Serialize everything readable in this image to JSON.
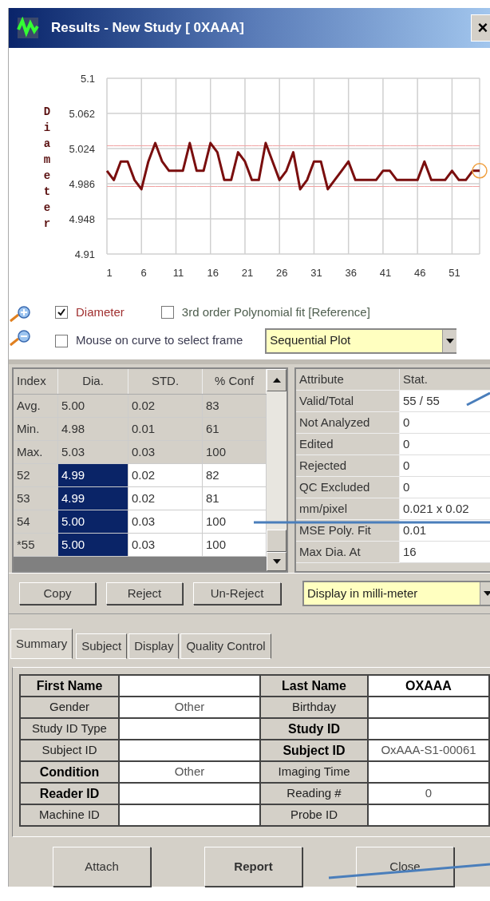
{
  "window": {
    "title": "Results - New Study [ 0XAAA]",
    "close": "×"
  },
  "plot": {
    "chart_data": {
      "type": "line",
      "ylabel": "Diameter",
      "x": [
        1,
        2,
        3,
        4,
        5,
        6,
        7,
        8,
        9,
        10,
        11,
        12,
        13,
        14,
        15,
        16,
        17,
        18,
        19,
        20,
        21,
        22,
        23,
        24,
        25,
        26,
        27,
        28,
        29,
        30,
        31,
        32,
        33,
        34,
        35,
        36,
        37,
        38,
        39,
        40,
        41,
        42,
        43,
        44,
        45,
        46,
        47,
        48,
        49,
        50,
        51,
        52,
        53,
        54,
        55
      ],
      "grid": true,
      "series": [
        {
          "color": "#7a0e0e",
          "values": [
            5.0,
            4.99,
            5.01,
            5.01,
            4.99,
            4.98,
            5.01,
            5.03,
            5.01,
            5.0,
            5.0,
            5.0,
            5.03,
            5.0,
            5.0,
            5.03,
            5.02,
            4.99,
            4.99,
            5.02,
            5.01,
            4.99,
            4.99,
            5.03,
            5.01,
            4.99,
            5.0,
            5.02,
            4.98,
            4.99,
            5.01,
            5.01,
            4.98,
            4.99,
            5.0,
            5.01,
            4.99,
            4.99,
            4.99,
            4.99,
            5.0,
            5.0,
            4.99,
            4.99,
            4.99,
            4.99,
            5.01,
            4.99,
            4.99,
            4.99,
            5.0,
            4.99,
            4.99,
            5.0,
            5.0
          ]
        },
        {
          "color": "#f0a0a0",
          "values": [
            5.027,
            5.027,
            5.027,
            5.027,
            5.027,
            5.027,
            5.027,
            5.027,
            5.027,
            5.027,
            5.027,
            5.027,
            5.027,
            5.027,
            5.027,
            5.027,
            5.027,
            5.027,
            5.027,
            5.027,
            5.027,
            5.027,
            5.027,
            5.027,
            5.027,
            5.027,
            5.027,
            5.027,
            5.027,
            5.027,
            5.027,
            5.027,
            5.027,
            5.027,
            5.027,
            5.027,
            5.027,
            5.027,
            5.027,
            5.027,
            5.027,
            5.027,
            5.027,
            5.027,
            5.027,
            5.027,
            5.027,
            5.027,
            5.027,
            5.027,
            5.027,
            5.027,
            5.027,
            5.027,
            5.027
          ]
        },
        {
          "color": "#f0a0a0",
          "values": [
            4.983,
            4.983,
            4.983,
            4.983,
            4.983,
            4.983,
            4.983,
            4.983,
            4.983,
            4.983,
            4.983,
            4.983,
            4.983,
            4.983,
            4.983,
            4.983,
            4.983,
            4.983,
            4.983,
            4.983,
            4.983,
            4.983,
            4.983,
            4.983,
            4.983,
            4.983,
            4.983,
            4.983,
            4.983,
            4.983,
            4.983,
            4.983,
            4.983,
            4.983,
            4.983,
            4.983,
            4.983,
            4.983,
            4.983,
            4.983,
            4.983,
            4.983,
            4.983,
            4.983,
            4.983,
            4.983,
            4.983,
            4.983,
            4.983,
            4.983,
            4.983,
            4.983,
            4.983,
            4.983,
            4.983
          ]
        }
      ],
      "xlim": [
        1,
        55
      ],
      "ylim": [
        4.91,
        5.1
      ],
      "xticks": [
        1,
        6,
        11,
        16,
        21,
        26,
        31,
        36,
        41,
        46,
        51
      ],
      "yticks": [
        {
          "value": 4.91,
          "label": "4.91"
        },
        {
          "value": 4.948,
          "label": "4.948"
        },
        {
          "value": 4.986,
          "label": "4.986"
        },
        {
          "value": 5.024,
          "label": "5.024"
        },
        {
          "value": 5.062,
          "label": "5.062"
        },
        {
          "value": 5.1,
          "label": "5.1"
        }
      ]
    }
  },
  "options": [
    {
      "label": "Diameter",
      "checked": true,
      "color": "#a03030"
    },
    {
      "label": "3rd order Polynomial fit [Reference]",
      "checked": false,
      "color": "#4f5f4f"
    },
    {
      "label": "Mouse on curve to select frame",
      "checked": false,
      "color": "#3a3a50"
    }
  ],
  "plot_mode": {
    "value": "Sequential Plot"
  },
  "frames": {
    "columns": [
      "Index",
      "Dia.",
      "STD.",
      "% Conf"
    ],
    "rows": [
      {
        "kind": "stat",
        "index": "Avg.",
        "dia": "5.00",
        "std": "0.02",
        "conf": "83",
        "selected": false
      },
      {
        "kind": "stat",
        "index": "Min.",
        "dia": "4.98",
        "std": "0.01",
        "conf": "61",
        "selected": false
      },
      {
        "kind": "stat",
        "index": "Max.",
        "dia": "5.03",
        "std": "0.03",
        "conf": "100",
        "selected": false
      },
      {
        "kind": "frame",
        "index": "52",
        "dia": "4.99",
        "std": "0.02",
        "conf": "82",
        "selected": true
      },
      {
        "kind": "frame",
        "index": "53",
        "dia": "4.99",
        "std": "0.02",
        "conf": "81",
        "selected": true
      },
      {
        "kind": "frame",
        "index": "54",
        "dia": "5.00",
        "std": "0.03",
        "conf": "100",
        "selected": true
      },
      {
        "kind": "frame",
        "index": "*55",
        "dia": "5.00",
        "std": "0.03",
        "conf": "100",
        "selected": true
      }
    ]
  },
  "stats": {
    "columns": [
      "Attribute",
      "Stat."
    ],
    "rows": [
      {
        "attribute": "Valid/Total",
        "stat": "55 / 55"
      },
      {
        "attribute": "Not Analyzed",
        "stat": "0"
      },
      {
        "attribute": "Edited",
        "stat": "0"
      },
      {
        "attribute": "Rejected",
        "stat": "0"
      },
      {
        "attribute": "QC Excluded",
        "stat": "0"
      },
      {
        "attribute": "mm/pixel",
        "stat": "0.021 x 0.02"
      },
      {
        "attribute": "MSE Poly. Fit",
        "stat": "0.01"
      },
      {
        "attribute": "Max Dia. At",
        "stat": "16"
      }
    ]
  },
  "actions": [
    "Copy",
    "Reject",
    "Un-Reject"
  ],
  "units": {
    "value": "Display in milli-meter"
  },
  "tabs": [
    {
      "label": "Summary",
      "selected": true
    },
    {
      "label": "Subject",
      "selected": false
    },
    {
      "label": "Display",
      "selected": false
    },
    {
      "label": "Quality Control",
      "selected": false
    }
  ],
  "summary": {
    "rows": [
      [
        {
          "kind": "label",
          "text": "First Name",
          "bold": true
        },
        {
          "kind": "value"
        },
        {
          "kind": "label",
          "text": "Last Name",
          "bold": true
        },
        {
          "kind": "value",
          "text": "OXAAA",
          "bold": true
        }
      ],
      [
        {
          "kind": "label",
          "text": "Gender"
        },
        {
          "kind": "value",
          "text": "Other"
        },
        {
          "kind": "label",
          "text": "Birthday"
        },
        {
          "kind": "value"
        }
      ],
      [
        {
          "kind": "label",
          "text": "Study ID Type"
        },
        {
          "kind": "value"
        },
        {
          "kind": "label",
          "text": "Study ID",
          "bold": true
        },
        {
          "kind": "value"
        }
      ],
      [
        {
          "kind": "label",
          "text": "Subject ID"
        },
        {
          "kind": "value"
        },
        {
          "kind": "label",
          "text": "Subject ID",
          "bold": true
        },
        {
          "kind": "value",
          "text": "OxAAA-S1-00061"
        }
      ],
      [
        {
          "kind": "label",
          "text": "Condition",
          "bold": true
        },
        {
          "kind": "value",
          "text": "Other"
        },
        {
          "kind": "label",
          "text": "Imaging Time"
        },
        {
          "kind": "value"
        }
      ],
      [
        {
          "kind": "label",
          "text": "Reader ID",
          "bold": true
        },
        {
          "kind": "value"
        },
        {
          "kind": "label",
          "text": "Reading #"
        },
        {
          "kind": "value",
          "text": "0"
        }
      ],
      [
        {
          "kind": "label",
          "text": "Machine ID"
        },
        {
          "kind": "value"
        },
        {
          "kind": "label",
          "text": "Probe ID"
        },
        {
          "kind": "value"
        }
      ]
    ]
  },
  "buttons": [
    {
      "label": "Attach",
      "bold": false
    },
    {
      "label": "Report",
      "bold": true
    },
    {
      "label": "Close",
      "bold": false
    }
  ]
}
